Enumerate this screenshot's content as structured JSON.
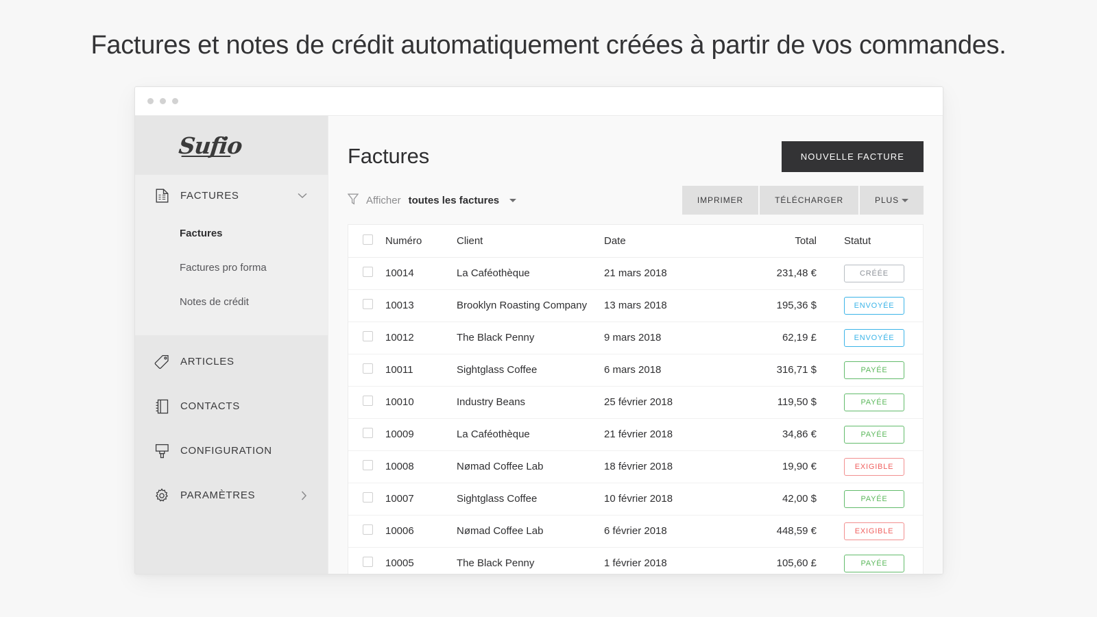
{
  "headline": "Factures et notes de crédit automatiquement créées à partir de vos commandes.",
  "window": {
    "dots": [
      "dot",
      "dot",
      "dot"
    ]
  },
  "sidebar": {
    "logo": "Sufio",
    "section": {
      "label": "FACTURES",
      "icon": "document-icon",
      "chevron": "chevron-down-icon",
      "subitems": [
        {
          "label": "Factures",
          "active": true
        },
        {
          "label": "Factures pro forma",
          "active": false
        },
        {
          "label": "Notes de crédit",
          "active": false
        }
      ]
    },
    "items": [
      {
        "label": "ARTICLES",
        "icon": "tag-icon",
        "chevron": ""
      },
      {
        "label": "CONTACTS",
        "icon": "address-book-icon",
        "chevron": ""
      },
      {
        "label": "CONFIGURATION",
        "icon": "paintbrush-icon",
        "chevron": ""
      },
      {
        "label": "PARAMÈTRES",
        "icon": "gear-icon",
        "chevron": "chevron-right-icon"
      }
    ]
  },
  "main": {
    "title": "Factures",
    "new_invoice_label": "NOUVELLE FACTURE",
    "filter": {
      "icon": "funnel-icon",
      "prefix": "Afficher",
      "value": "toutes les factures"
    },
    "actions": [
      {
        "label": "IMPRIMER",
        "caret": false
      },
      {
        "label": "TÉLÉCHARGER",
        "caret": false
      },
      {
        "label": "PLUS",
        "caret": true
      }
    ],
    "table": {
      "columns": {
        "number": "Numéro",
        "client": "Client",
        "date": "Date",
        "total": "Total",
        "status": "Statut"
      },
      "rows": [
        {
          "number": "10014",
          "client": "La Caféothèque",
          "date": "21 mars 2018",
          "total": "231,48 €",
          "status": "CRÉÉE",
          "status_kind": "creee"
        },
        {
          "number": "10013",
          "client": "Brooklyn Roasting Company",
          "date": "13 mars 2018",
          "total": "195,36 $",
          "status": "ENVOYÉE",
          "status_kind": "envoyee"
        },
        {
          "number": "10012",
          "client": "The Black Penny",
          "date": "9 mars 2018",
          "total": "62,19 £",
          "status": "ENVOYÉE",
          "status_kind": "envoyee"
        },
        {
          "number": "10011",
          "client": "Sightglass Coffee",
          "date": "6 mars 2018",
          "total": "316,71 $",
          "status": "PAYÉE",
          "status_kind": "payee"
        },
        {
          "number": "10010",
          "client": "Industry Beans",
          "date": "25 février 2018",
          "total": "119,50 $",
          "status": "PAYÉE",
          "status_kind": "payee"
        },
        {
          "number": "10009",
          "client": "La Caféothèque",
          "date": "21 février 2018",
          "total": "34,86 €",
          "status": "PAYÉE",
          "status_kind": "payee"
        },
        {
          "number": "10008",
          "client": "Nømad Coffee Lab",
          "date": "18 février 2018",
          "total": "19,90 €",
          "status": "EXIGIBLE",
          "status_kind": "exigible"
        },
        {
          "number": "10007",
          "client": "Sightglass Coffee",
          "date": "10 février 2018",
          "total": "42,00 $",
          "status": "PAYÉE",
          "status_kind": "payee"
        },
        {
          "number": "10006",
          "client": "Nømad Coffee Lab",
          "date": "6 février 2018",
          "total": "448,59 €",
          "status": "EXIGIBLE",
          "status_kind": "exigible"
        },
        {
          "number": "10005",
          "client": "The Black Penny",
          "date": "1 février 2018",
          "total": "105,60 £",
          "status": "PAYÉE",
          "status_kind": "payee"
        }
      ]
    }
  },
  "colors": {
    "accent_dark": "#333335",
    "status_sent": "#3bb4e8",
    "status_paid": "#5cb85c",
    "status_due": "#f0605f",
    "status_created": "#8d9299"
  }
}
